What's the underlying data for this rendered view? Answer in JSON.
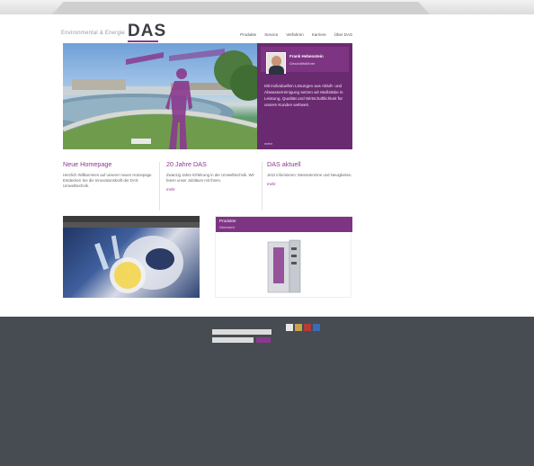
{
  "top_links": [
    "",
    "",
    ""
  ],
  "header": {
    "tagline": "Environmental & Energie",
    "logo": "DAS",
    "nav": [
      "Produkte",
      "Service",
      "Verfahren",
      "Karriere",
      "Über DAS"
    ]
  },
  "hero": {
    "sign_text": "Umwelttechnik",
    "panel": {
      "name": "Frank Hebenstein",
      "role": "Geschäftsführer",
      "text": "Mit individuellen Lösungen aus Abluft- und Abwasserreinigung setzen wir Maßstäbe in Leistung, Qualität und Wirtschaftlichkeit für unsere Kunden weltweit.",
      "link": "mehr"
    }
  },
  "teasers": [
    {
      "title": "Neue Homepage",
      "text": "Herzlich Willkommen auf unserer neuen Homepage. Entdecken Sie die Innovationskraft der DAS Umwelttechnik.",
      "more": ""
    },
    {
      "title": "20 Jahre DAS",
      "text": "Zwanzig Jahre Erfahrung in der Umwelttechnik. Wir feiern unser Jubiläum mit Ihnen.",
      "more": "mehr"
    },
    {
      "title": "DAS aktuell",
      "text": "Jetzt informieren: Messetermine und Neuigkeiten.",
      "more": "mehr"
    }
  ],
  "box_left": {
    "title": "",
    "subtitle": ""
  },
  "box_right": {
    "title": "Produkte",
    "subtitle": "Übersicht"
  },
  "footer": {
    "col1": {
      "heading": "",
      "items": [
        "",
        "",
        "",
        "",
        "",
        "",
        ""
      ]
    },
    "col2": {
      "heading": "",
      "items": [
        "",
        "",
        "",
        "",
        "",
        "",
        "",
        "",
        "",
        "",
        "",
        "",
        "",
        "",
        "",
        "",
        "",
        "",
        "",
        "",
        "",
        "",
        "",
        ""
      ]
    },
    "col3": {
      "heading": "",
      "items": [
        "",
        "",
        "",
        "",
        ""
      ],
      "heading2": "",
      "items2": [
        "",
        "",
        "",
        "",
        ""
      ],
      "search_placeholder": "",
      "email_placeholder": "",
      "button": ""
    },
    "links": [
      "",
      "",
      "",
      "",
      ""
    ]
  },
  "colors": {
    "brand": "#7d3583",
    "footer": "#464c52"
  }
}
